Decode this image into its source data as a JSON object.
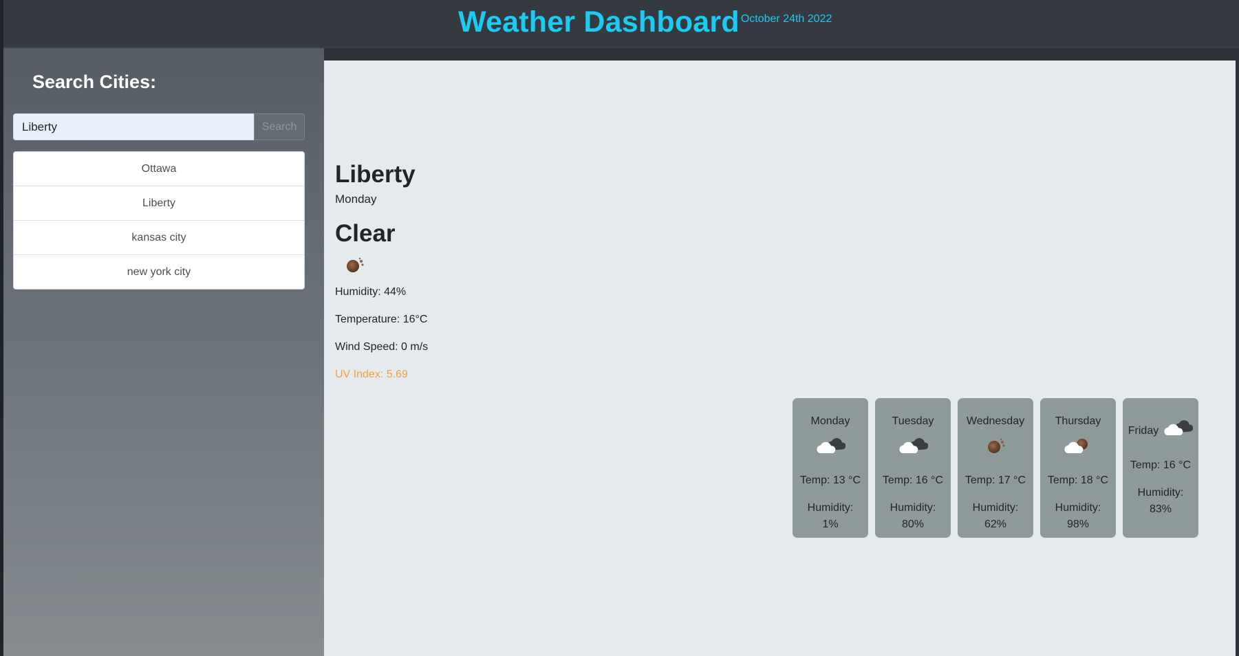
{
  "header": {
    "title": "Weather Dashboard",
    "date": "October 24th 2022",
    "accent_color": "#1ccaf2"
  },
  "sidebar": {
    "heading": "Search Cities:",
    "search": {
      "value": "Liberty",
      "button_label": "Search"
    },
    "cities": [
      "Ottawa",
      "Liberty",
      "kansas city",
      "new york city"
    ]
  },
  "current": {
    "city": "Liberty",
    "day": "Monday",
    "condition": "Clear",
    "icon": "clear-night-icon",
    "humidity": "Humidity: 44%",
    "temperature": "Temperature: 16°C",
    "wind": "Wind Speed: 0 m/s",
    "uv": "UV Index: 5.69",
    "uv_color": "#f6a13b"
  },
  "forecast": [
    {
      "day": "Monday",
      "icon": "cloudy-icon",
      "temp": "Temp: 13 °C",
      "humidity": "Humidity: 1%"
    },
    {
      "day": "Tuesday",
      "icon": "cloudy-icon",
      "temp": "Temp: 16 °C",
      "humidity": "Humidity: 80%"
    },
    {
      "day": "Wednesday",
      "icon": "clear-night-icon",
      "temp": "Temp: 17 °C",
      "humidity": "Humidity: 62%"
    },
    {
      "day": "Thursday",
      "icon": "partly-cloudy-icon",
      "temp": "Temp: 18 °C",
      "humidity": "Humidity: 98%"
    },
    {
      "day": "Friday",
      "icon": "cloudy-icon",
      "temp": "Temp: 16 °C",
      "humidity": "Humidity: 83%"
    }
  ]
}
